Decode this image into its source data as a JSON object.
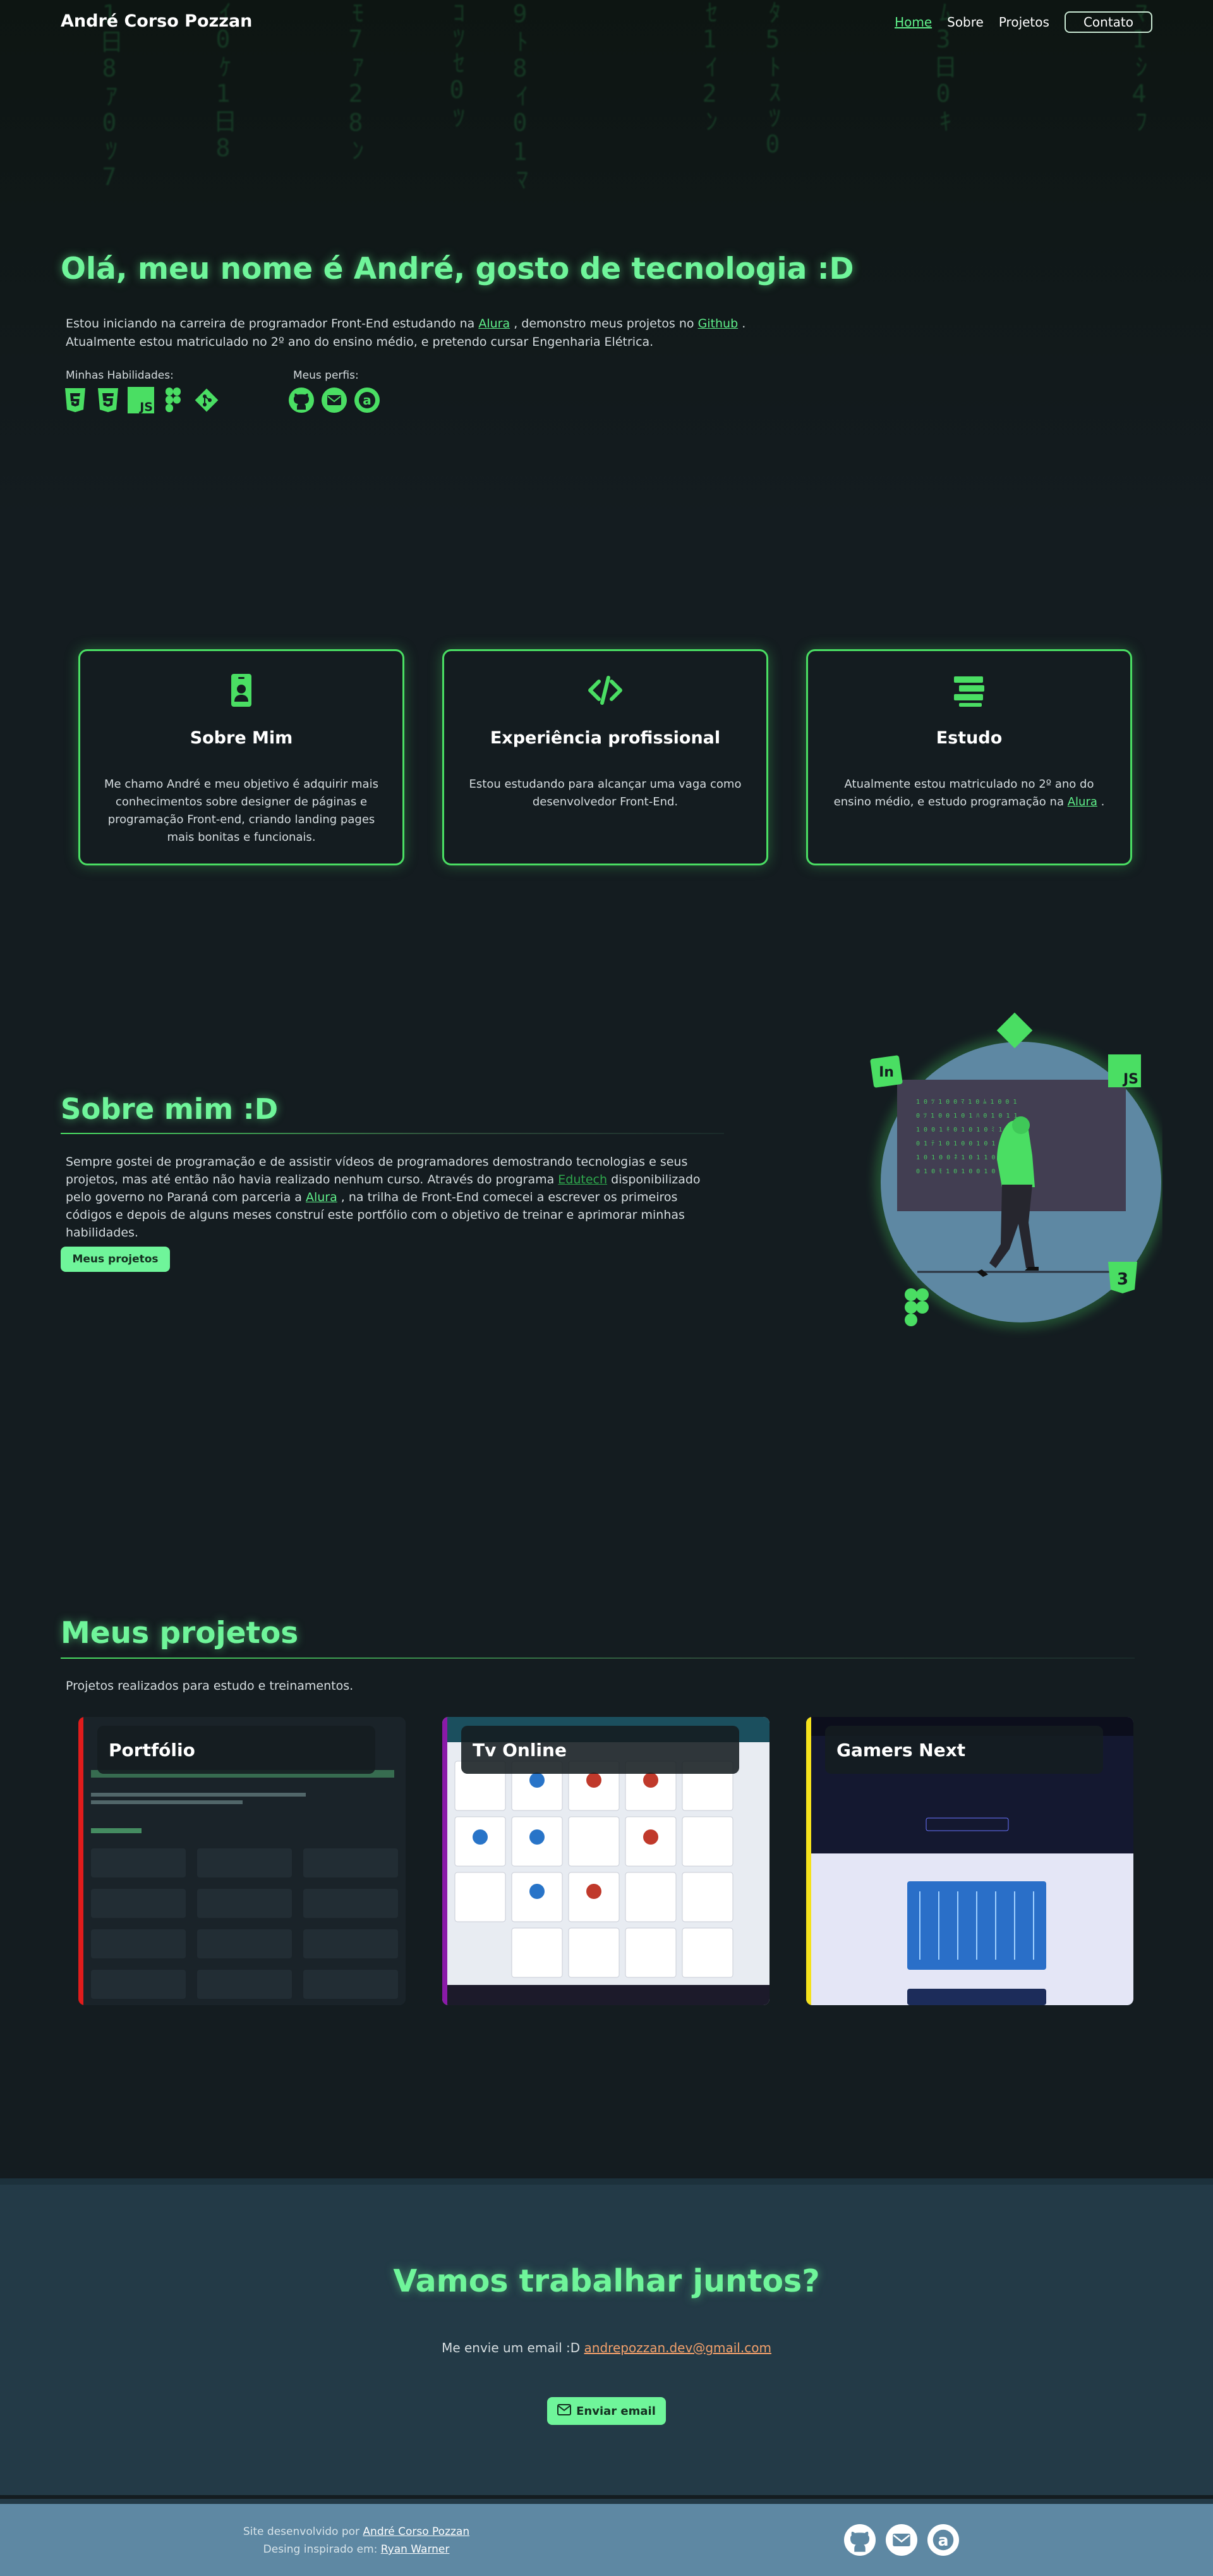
{
  "nav": {
    "brand": "André Corso Pozzan",
    "links": [
      "Home",
      "Sobre",
      "Projetos"
    ],
    "contact": "Contato"
  },
  "hero": {
    "title": "Olá, meu nome é André, gosto de tecnologia :D",
    "text_before_alura": "Estou iniciando na carreira de programador Front-End estudando na",
    "link_alura": "Alura",
    "text_middle": ", demonstro meus projetos no",
    "link_github": "Github",
    "text_after": ". Atualmente estou matriculado no 2º ano do ensino médio, e pretendo cursar Engenharia Elétrica.",
    "skills_label": "Minhas Habilidades:",
    "profiles_label": "Meus perfis:",
    "skills_icons": [
      "html5-icon",
      "css3-icon",
      "javascript-icon",
      "figma-icon",
      "git-icon"
    ],
    "profile_icons": [
      "github-icon",
      "email-icon",
      "alura-icon"
    ]
  },
  "cards": [
    {
      "icon": "id-badge-icon",
      "title": "Sobre Mim",
      "text": "Me chamo André e meu objetivo é adquirir mais conhecimentos sobre designer de páginas e programação Front-end, criando landing pages mais bonitas e funcionais."
    },
    {
      "icon": "code-icon",
      "title": "Experiência profissional",
      "text": "Estou estudando para alcançar uma vaga como desenvolvedor Front-End."
    },
    {
      "icon": "study-icon",
      "title": "Estudo",
      "text_before": "Atualmente estou matriculado no 2º ano do ensino médio, e estudo programação na",
      "link": "Alura",
      "text_after": "."
    }
  ],
  "about": {
    "title": "Sobre mim :D",
    "text_1": "Sempre gostei de programação e de assistir vídeos de programadores demostrando tecnologias e seus projetos, mas até então não havia realizado nenhum curso. Através do programa",
    "link_edutech": "Edutech",
    "text_2": "disponibilizado pelo governo no Paraná com parceria a",
    "link_alura": "Alura",
    "text_3": ", na trilha de Front-End comecei a escrever os primeiros códigos e depois de alguns meses construí este portfólio com o objetivo de treinar e aprimorar minhas habilidades.",
    "button": "Meus projetos"
  },
  "projects": {
    "title": "Meus projetos",
    "subtitle": "Projetos realizados para estudo e treinamentos.",
    "items": [
      {
        "title": "Portfólio",
        "color": "#e01c1c"
      },
      {
        "title": "Tv Online",
        "color": "#8a1aa8"
      },
      {
        "title": "Gamers Next",
        "color": "#f5e21c"
      }
    ]
  },
  "contact": {
    "title": "Vamos trabalhar juntos?",
    "text": "Me envie um email :D",
    "email": "andrepozzan.dev@gmail.com",
    "button": "Enviar email"
  },
  "footer": {
    "line1_prefix": "Site desenvolvido por",
    "line1_link": "André Corso Pozzan",
    "line2_prefix": "Desing inspirado em:",
    "line2_link": "Ryan Warner"
  },
  "colors": {
    "accent": "#6ff59a",
    "card_border": "#4ade63",
    "background": "#141c20",
    "contact_bg": "#233a47",
    "footer_bg": "#5e88a3"
  }
}
